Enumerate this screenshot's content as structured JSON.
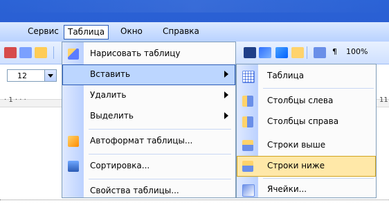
{
  "menubar": {
    "items": [
      {
        "id": "service",
        "label": "Сервис",
        "active": false
      },
      {
        "id": "table",
        "label": "Таблица",
        "active": true
      },
      {
        "id": "window",
        "label": "Окно",
        "active": false
      },
      {
        "id": "help",
        "label": "Справка",
        "active": false
      }
    ]
  },
  "toolbar": {
    "font_size": "12",
    "zoom": "100%"
  },
  "menu": {
    "items": [
      {
        "label": "Нарисовать таблицу"
      },
      {
        "label": "Вставить"
      },
      {
        "label": "Удалить"
      },
      {
        "label": "Выделить"
      },
      {
        "label": "Автоформат таблицы..."
      },
      {
        "label": "Сортировка..."
      },
      {
        "label": "Свойства таблицы..."
      }
    ],
    "submenu": {
      "items": [
        {
          "label": "Таблица"
        },
        {
          "label": "Столбцы слева"
        },
        {
          "label": "Столбцы справа"
        },
        {
          "label": "Строки выше"
        },
        {
          "label": "Строки ниже"
        },
        {
          "label": "Ячейки..."
        }
      ]
    }
  },
  "colors": {
    "title_bar": "#2b63d6",
    "menu_highlight": "#bcd6ff",
    "submenu_highlight": "#ffe8a8"
  }
}
